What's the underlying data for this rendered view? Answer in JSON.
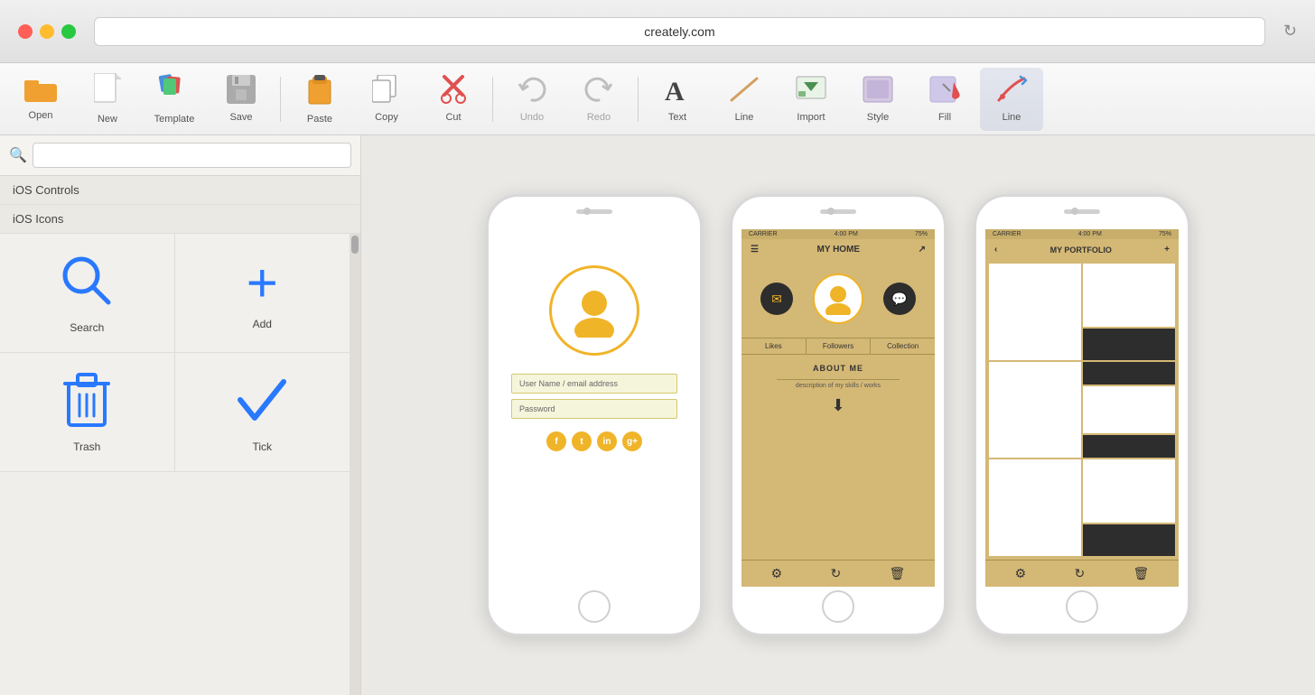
{
  "browser": {
    "url": "creately.com",
    "refresh_icon": "↻"
  },
  "toolbar": {
    "items": [
      {
        "id": "open",
        "label": "Open",
        "icon": "folder"
      },
      {
        "id": "new",
        "label": "New",
        "icon": "new-doc"
      },
      {
        "id": "template",
        "label": "Template",
        "icon": "template"
      },
      {
        "id": "save",
        "label": "Save",
        "icon": "save"
      },
      {
        "id": "paste",
        "label": "Paste",
        "icon": "paste"
      },
      {
        "id": "copy",
        "label": "Copy",
        "icon": "copy"
      },
      {
        "id": "cut",
        "label": "Cut",
        "icon": "cut"
      },
      {
        "id": "undo",
        "label": "Undo",
        "icon": "undo"
      },
      {
        "id": "redo",
        "label": "Redo",
        "icon": "redo"
      },
      {
        "id": "text",
        "label": "Text",
        "icon": "text"
      },
      {
        "id": "line",
        "label": "Line",
        "icon": "line"
      },
      {
        "id": "import",
        "label": "Import",
        "icon": "import"
      },
      {
        "id": "style",
        "label": "Style",
        "icon": "style"
      },
      {
        "id": "fill",
        "label": "Fill",
        "icon": "fill"
      },
      {
        "id": "line2",
        "label": "Line",
        "icon": "line2",
        "active": true
      }
    ]
  },
  "sidebar": {
    "search_placeholder": "",
    "sections": [
      {
        "id": "ios-controls",
        "label": "iOS Controls"
      },
      {
        "id": "ios-icons",
        "label": "iOS Icons"
      }
    ],
    "icons": [
      {
        "id": "search",
        "label": "Search",
        "type": "search"
      },
      {
        "id": "add",
        "label": "Add",
        "type": "add"
      },
      {
        "id": "trash",
        "label": "Trash",
        "type": "trash"
      },
      {
        "id": "tick",
        "label": "Tick",
        "type": "tick"
      }
    ]
  },
  "phones": [
    {
      "id": "phone1",
      "type": "login",
      "username_placeholder": "User Name / email address",
      "password_placeholder": "Password",
      "social_icons": [
        "f",
        "t",
        "in",
        "g+"
      ]
    },
    {
      "id": "phone2",
      "type": "myhome",
      "carrier": "CARRIER",
      "time": "4:00 PM",
      "battery": "75%",
      "title": "MY HOME",
      "tabs": [
        "Likes",
        "Followers",
        "Collection"
      ],
      "about_title": "ABOUT ME",
      "about_desc": "description of my skills / works"
    },
    {
      "id": "phone3",
      "type": "portfolio",
      "carrier": "CARRIER",
      "time": "4:00 PM",
      "battery": "75%",
      "title": "MY PORTFOLIO"
    }
  ]
}
